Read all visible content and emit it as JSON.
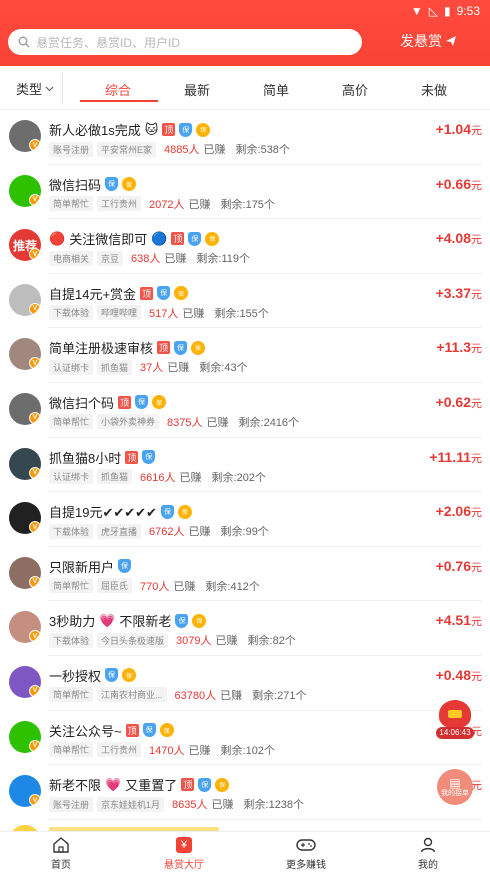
{
  "status_bar": {
    "time": "9:53"
  },
  "search": {
    "placeholder": "悬赏任务、悬赏ID、用户ID"
  },
  "publish_label": "发悬赏",
  "filter": {
    "type_label": "类型",
    "tabs": [
      "综合",
      "最新",
      "简单",
      "高价",
      "未做"
    ],
    "active_tab": "综合"
  },
  "tasks": [
    {
      "title": "新人必做1s完成",
      "emoji": "🐱",
      "top": true,
      "shield": true,
      "bao": true,
      "tags": [
        "账号注册",
        "平安常州E家"
      ],
      "count": "4885人",
      "earned": "已赚",
      "remaining": "剩余:538个",
      "price_sign": "+",
      "price": "1.04",
      "unit": "元",
      "avatar_color": "#6d6d6d",
      "avatar_text": ""
    },
    {
      "title": "微信扫码",
      "emoji": "",
      "top": false,
      "shield": true,
      "bao": true,
      "tags": [
        "简单帮忙",
        "工行贵州"
      ],
      "count": "2072人",
      "earned": "已赚",
      "remaining": "剩余:175个",
      "price_sign": "+",
      "price": "0.66",
      "unit": "元",
      "avatar_color": "#2dc100",
      "avatar_text": ""
    },
    {
      "title": "关注微信即可",
      "emoji": "🔵",
      "prefix": "🔴",
      "top": true,
      "shield": true,
      "bao": true,
      "tags": [
        "电商相关",
        "京豆"
      ],
      "count": "638人",
      "earned": "已赚",
      "remaining": "剩余:119个",
      "price_sign": "+",
      "price": "4.08",
      "unit": "元",
      "avatar_color": "#e53935",
      "avatar_text": "推荐"
    },
    {
      "title": "自提14元+赏金",
      "emoji": "",
      "top": true,
      "shield": true,
      "bao": true,
      "tags": [
        "下载体验",
        "哔哩哔哩"
      ],
      "count": "517人",
      "earned": "已赚",
      "remaining": "剩余:155个",
      "price_sign": "+",
      "price": "3.37",
      "unit": "元",
      "avatar_color": "#bdbdbd",
      "avatar_text": ""
    },
    {
      "title": "简单注册极速审核",
      "emoji": "",
      "top": true,
      "shield": true,
      "bao": true,
      "tags": [
        "认证绑卡",
        "抓鱼猫"
      ],
      "count": "37人",
      "earned": "已赚",
      "remaining": "剩余:43个",
      "price_sign": "+",
      "price": "11.3",
      "unit": "元",
      "avatar_color": "#a1887f",
      "avatar_text": ""
    },
    {
      "title": "微信扫个码",
      "emoji": "",
      "top": true,
      "shield": true,
      "bao": true,
      "tags": [
        "简单帮忙",
        "小袋外卖神券"
      ],
      "count": "8375人",
      "earned": "已赚",
      "remaining": "剩余:2416个",
      "price_sign": "+",
      "price": "0.62",
      "unit": "元",
      "avatar_color": "#6d6d6d",
      "avatar_text": ""
    },
    {
      "title": "抓鱼猫8小时",
      "emoji": "",
      "top": true,
      "shield": true,
      "bao": false,
      "tags": [
        "认证绑卡",
        "抓鱼猫"
      ],
      "count": "6616人",
      "earned": "已赚",
      "remaining": "剩余:202个",
      "price_sign": "+",
      "price": "11.11",
      "unit": "元",
      "avatar_color": "#37474f",
      "avatar_text": ""
    },
    {
      "title": "自提19元✔✔✔✔✔",
      "emoji": "",
      "top": false,
      "shield": true,
      "bao": true,
      "tags": [
        "下载体验",
        "虎牙直播"
      ],
      "count": "6762人",
      "earned": "已赚",
      "remaining": "剩余:99个",
      "price_sign": "+",
      "price": "2.06",
      "unit": "元",
      "avatar_color": "#212121",
      "avatar_text": ""
    },
    {
      "title": "只限新用户",
      "emoji": "",
      "top": false,
      "shield": true,
      "bao": false,
      "tags": [
        "简单帮忙",
        "屈臣氏"
      ],
      "count": "770人",
      "earned": "已赚",
      "remaining": "剩余:412个",
      "price_sign": "+",
      "price": "0.76",
      "unit": "元",
      "avatar_color": "#8d6e63",
      "avatar_text": ""
    },
    {
      "title": "3秒助力",
      "emoji": "💗",
      "suffix": "不限新老",
      "top": false,
      "shield": true,
      "bao": true,
      "tags": [
        "下载体验",
        "今日头条极速版"
      ],
      "count": "3079人",
      "earned": "已赚",
      "remaining": "剩余:82个",
      "price_sign": "+",
      "price": "4.51",
      "unit": "元",
      "avatar_color": "#c48f80",
      "avatar_text": ""
    },
    {
      "title": "一秒授权",
      "emoji": "",
      "top": false,
      "shield": true,
      "bao": true,
      "tags": [
        "简单帮忙",
        "江南农村商业..."
      ],
      "count": "63780人",
      "earned": "已赚",
      "remaining": "剩余:271个",
      "price_sign": "+",
      "price": "0.48",
      "unit": "元",
      "avatar_color": "#7e57c2",
      "avatar_text": ""
    },
    {
      "title": "关注公众号~",
      "emoji": "",
      "top": true,
      "shield": true,
      "bao": true,
      "tags": [
        "简单帮忙",
        "工行贵州"
      ],
      "count": "1470人",
      "earned": "已赚",
      "remaining": "剩余:102个",
      "price_sign": "",
      "price": "",
      "unit": "元",
      "avatar_color": "#2dc100",
      "avatar_text": ""
    },
    {
      "title": "新老不限",
      "emoji": "💗",
      "suffix": "又重置了",
      "top": true,
      "shield": true,
      "bao": true,
      "tags": [
        "账号注册",
        "京东娃娃机1月"
      ],
      "count": "8635人",
      "earned": "已赚",
      "remaining": "剩余:1238个",
      "price_sign": "",
      "price": "",
      "unit": "元",
      "avatar_color": "#1e88e5",
      "avatar_text": ""
    }
  ],
  "badges": {
    "top": "顶",
    "shield": "保",
    "bao": "保"
  },
  "floating": {
    "timer": "14:06:43",
    "order_label": "我的接单"
  },
  "bottom_nav": [
    {
      "label": "首页",
      "icon": "home-icon"
    },
    {
      "label": "悬赏大厅",
      "icon": "yen-icon"
    },
    {
      "label": "更多赚钱",
      "icon": "gamepad-icon"
    },
    {
      "label": "我的",
      "icon": "user-icon"
    }
  ],
  "colors": {
    "accent": "#f44336",
    "price": "#e53935",
    "header": "#ff4a3d"
  }
}
